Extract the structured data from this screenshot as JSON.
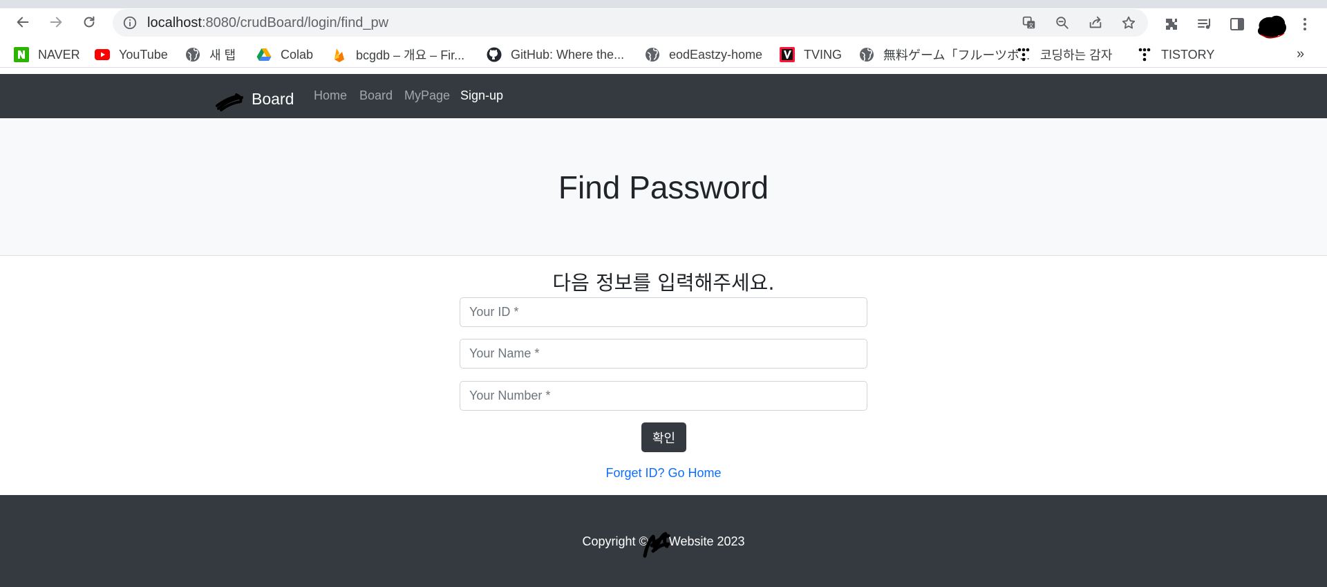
{
  "browser": {
    "url_host": "localhost",
    "url_rest": ":8080/crudBoard/login/find_pw",
    "back_icon": "arrow-left-icon",
    "forward_icon": "arrow-right-icon",
    "reload_icon": "reload-icon",
    "info_icon": "info-icon",
    "omnibox_icons": [
      "translate-icon",
      "zoom-out-icon",
      "share-icon",
      "star-icon"
    ],
    "toolbar_icons": [
      "extensions-icon",
      "media-queue-icon",
      "side-panel-icon",
      "menu-kebab-icon"
    ],
    "more_bookmarks": "»"
  },
  "bookmarks": [
    {
      "label": "NAVER",
      "icon": "naver-icon",
      "color": "#2db400"
    },
    {
      "label": "YouTube",
      "icon": "youtube-icon",
      "color": "#ff0000"
    },
    {
      "label": "새 탭",
      "icon": "globe-icon",
      "color": "#5f6368"
    },
    {
      "label": "Colab",
      "icon": "google-drive-icon",
      "color": "#f9ab00"
    },
    {
      "label": "bcgdb – 개요 – Fir...",
      "icon": "firebase-icon",
      "color": "#ffa000"
    },
    {
      "label": "GitHub: Where the...",
      "icon": "github-icon",
      "color": "#24292f"
    },
    {
      "label": "eodEastzy-home",
      "icon": "globe-icon",
      "color": "#5f6368"
    },
    {
      "label": "TVING",
      "icon": "tving-icon",
      "color": "#ff153c"
    },
    {
      "label": "無料ゲーム「フルーツボ...",
      "icon": "globe-icon",
      "color": "#5f6368"
    },
    {
      "label": "코딩하는 감자",
      "icon": "tistory-icon",
      "color": "#000000"
    },
    {
      "label": "TISTORY",
      "icon": "tistory-icon",
      "color": "#000000"
    }
  ],
  "navbar": {
    "brand": "Board",
    "links": [
      "Home",
      "Board",
      "MyPage",
      "Sign-up"
    ],
    "active_link": "Sign-up"
  },
  "header": {
    "title": "Find Password"
  },
  "form": {
    "heading": "다음 정보를 입력해주세요.",
    "id_placeholder": "Your ID *",
    "name_placeholder": "Your Name *",
    "number_placeholder": "Your Number *",
    "submit_label": "확인",
    "home_link": "Forget ID? Go Home"
  },
  "footer": {
    "text": "Copyright ©      Website 2023"
  },
  "colors": {
    "nav_bg": "#343a40",
    "header_bg": "#f8f9fa",
    "link": "#0d6efd"
  }
}
